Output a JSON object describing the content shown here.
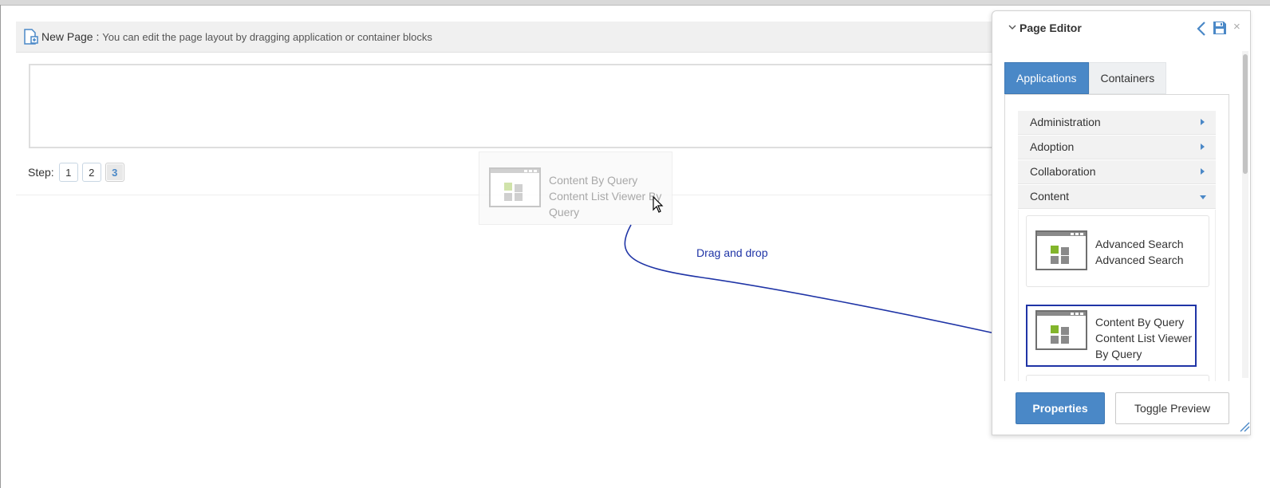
{
  "toolbar": {
    "page_title": "New Page",
    "separator": " : ",
    "description": "You can edit the page layout by dragging application or container blocks"
  },
  "steps": {
    "label": "Step:",
    "items": [
      "1",
      "2",
      "3"
    ],
    "active": "3"
  },
  "drag_ghost": {
    "title": "Content By Query",
    "description": "Content List Viewer By Query"
  },
  "annotation": {
    "label": "Drag and drop",
    "color": "#1f34a6"
  },
  "page_editor": {
    "title": "Page Editor",
    "tabs": [
      "Applications",
      "Containers"
    ],
    "active_tab": "Applications",
    "categories": [
      "Administration",
      "Adoption",
      "Collaboration",
      "Content"
    ],
    "expanded_category": "Content",
    "applications": [
      {
        "title": "Advanced Search",
        "description": "Advanced Search"
      },
      {
        "title": "Content By Query",
        "description": "Content List Viewer By Query",
        "selected": true
      }
    ],
    "buttons": {
      "properties": "Properties",
      "toggle_preview": "Toggle Preview"
    }
  },
  "colors": {
    "accent": "#4a88c7",
    "highlight": "#1f34a6",
    "app_icon_green": "#82b52b"
  }
}
